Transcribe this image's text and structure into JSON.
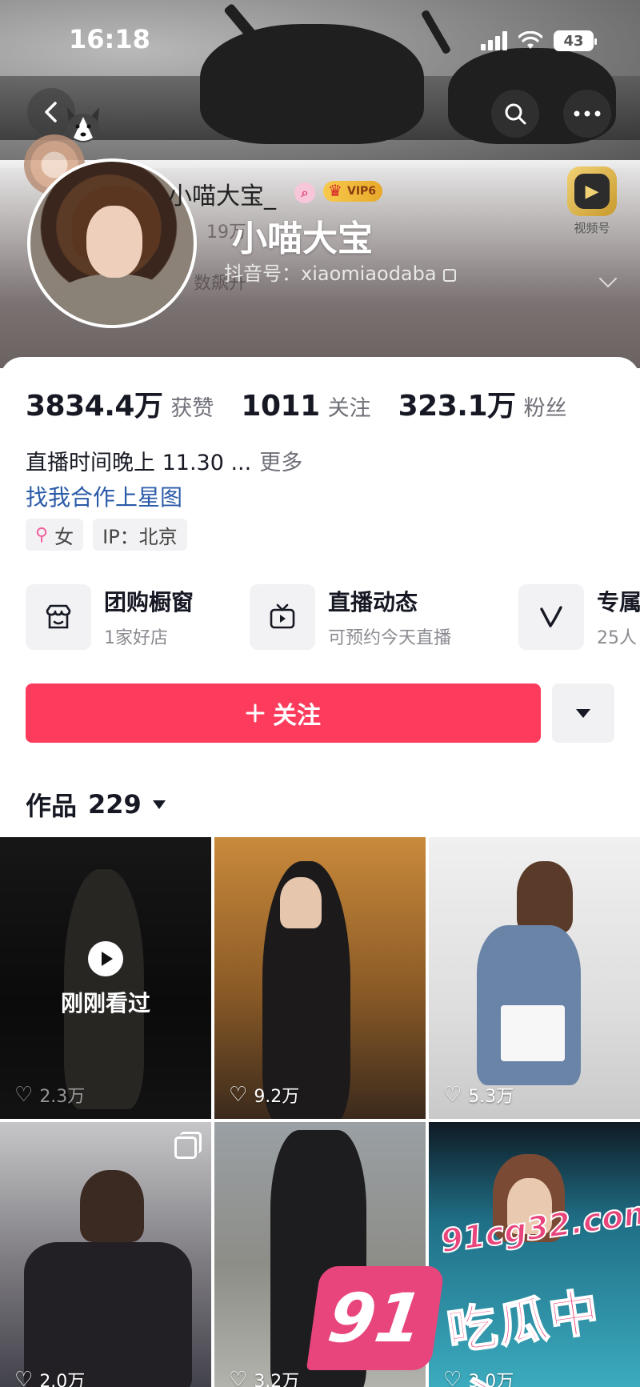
{
  "status_bar": {
    "time": "16:18",
    "battery": "43"
  },
  "profile": {
    "name_small": "小喵大宝_",
    "name_big": "小喵大宝",
    "vip_label": "VIP6",
    "faded_1": "19万",
    "faded_2": "数飙升",
    "douyin_id": "抖音号：xiaomiaodaba",
    "video_badge_label": "视频号"
  },
  "stats": [
    {
      "value": "3834.4万",
      "label": "获赞"
    },
    {
      "value": "1011",
      "label": "关注"
    },
    {
      "value": "323.1万",
      "label": "粉丝"
    }
  ],
  "bio": {
    "text": "直播时间晚上 11.30 ...",
    "more": "更多",
    "collab": "找我合作上星图"
  },
  "tags": {
    "gender": "女",
    "ip": "IP：北京"
  },
  "services": [
    {
      "title": "团购橱窗",
      "subtitle": "1家好店",
      "icon": "shop-icon"
    },
    {
      "title": "直播动态",
      "subtitle": "可预约今天直播",
      "icon": "tv-icon"
    },
    {
      "title": "专属",
      "subtitle": "25人",
      "icon": "v-icon"
    }
  ],
  "follow_button": "关注",
  "works": {
    "label": "作品",
    "count": "229"
  },
  "grid": [
    {
      "likes": "2.3万",
      "overlay": "刚刚看过"
    },
    {
      "likes": "9.2万"
    },
    {
      "likes": "5.3万"
    },
    {
      "likes": "2.0万"
    },
    {
      "likes": "3.2万"
    },
    {
      "likes": "3.0万"
    }
  ],
  "watermark": {
    "number": "91",
    "url": "91cg32.com",
    "text": "吃瓜中心"
  },
  "colors": {
    "accent": "#fd3c5d",
    "link": "#2a5aa8",
    "watermark": "#e8457c"
  }
}
